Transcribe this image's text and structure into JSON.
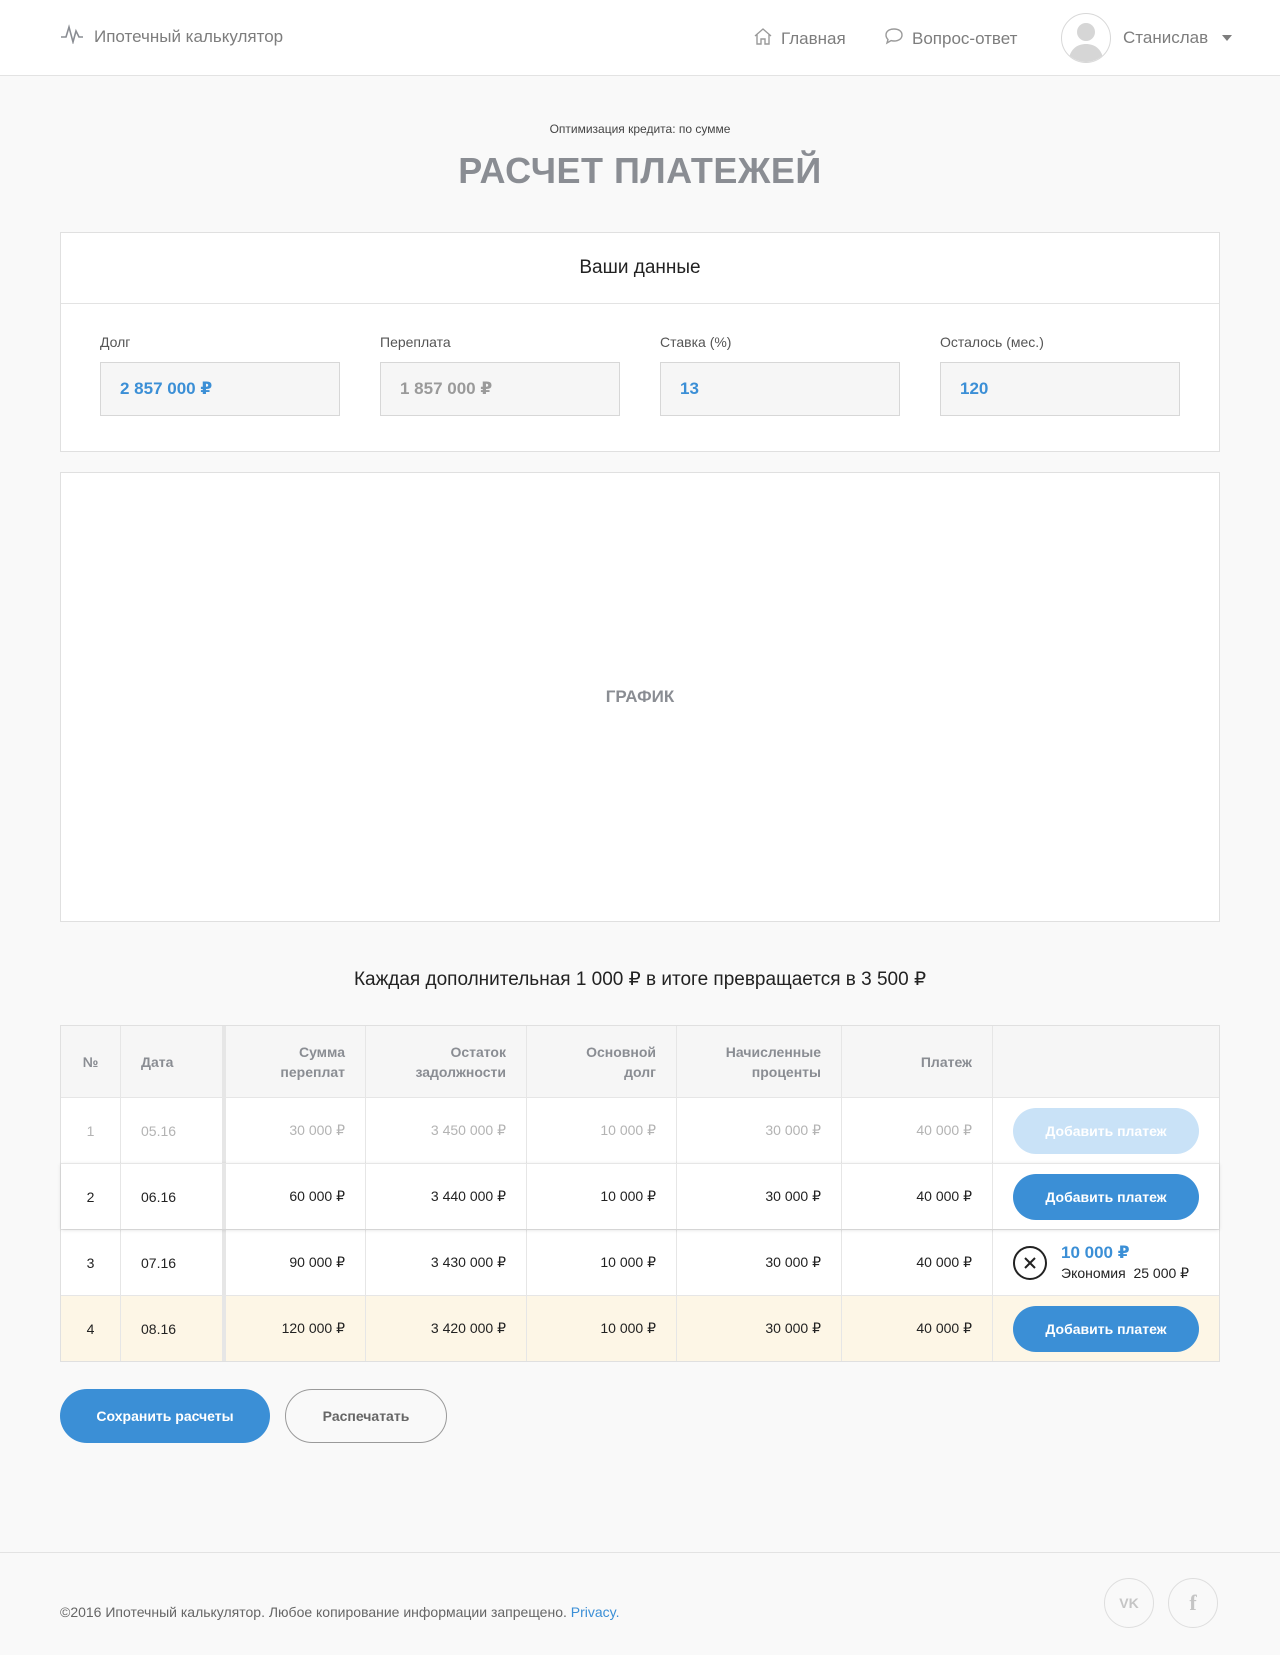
{
  "header": {
    "logo_text": "Ипотечный калькулятор",
    "nav_home": "Главная",
    "nav_faq": "Вопрос-ответ",
    "user_name": "Станислав"
  },
  "page": {
    "subtitle": "Оптимизация кредита: по сумме",
    "title": "РАСЧЕТ ПЛАТЕЖЕЙ"
  },
  "data_card": {
    "heading": "Ваши данные",
    "fields": [
      {
        "label": "Долг",
        "value": "2 857 000 ₽"
      },
      {
        "label": "Переплата",
        "value": "1 857 000 ₽"
      },
      {
        "label": "Ставка (%)",
        "value": "13"
      },
      {
        "label": "Осталось (мес.)",
        "value": "120"
      }
    ]
  },
  "chart_placeholder": "ГРАФИК",
  "promo_text": "Каждая дополнительная 1 000 ₽ в итоге превращается в 3 500 ₽",
  "table": {
    "headers": {
      "num": "№",
      "date": "Дата",
      "overpay_1": "Сумма",
      "overpay_2": "переплат",
      "debt_1": "Остаток",
      "debt_2": "задолжности",
      "main_1": "Основной",
      "main_2": "долг",
      "interest_1": "Начисленные",
      "interest_2": "проценты",
      "payment": "Платеж"
    },
    "rows": [
      {
        "num": "1",
        "date": "05.16",
        "overpay": "30 000 ₽",
        "debt": "3 450 000 ₽",
        "main": "10 000 ₽",
        "interest": "30 000 ₽",
        "payment": "40 000 ₽",
        "action": "Добавить платеж"
      },
      {
        "num": "2",
        "date": "06.16",
        "overpay": "60 000 ₽",
        "debt": "3 440 000 ₽",
        "main": "10 000 ₽",
        "interest": "30 000 ₽",
        "payment": "40 000 ₽",
        "action": "Добавить платеж"
      },
      {
        "num": "3",
        "date": "07.16",
        "overpay": "90 000 ₽",
        "debt": "3 430 000 ₽",
        "main": "10 000 ₽",
        "interest": "30 000 ₽",
        "payment": "40 000 ₽",
        "extra_amount": "10 000 ₽",
        "extra_saving_label": "Экономия",
        "extra_saving_value": "25 000 ₽"
      },
      {
        "num": "4",
        "date": "08.16",
        "overpay": "120 000 ₽",
        "debt": "3 420 000 ₽",
        "main": "10 000 ₽",
        "interest": "30 000 ₽",
        "payment": "40 000 ₽",
        "action": "Добавить платеж"
      }
    ]
  },
  "buttons": {
    "save": "Сохранить расчеты",
    "print": "Распечатать"
  },
  "footer": {
    "copyright": "©2016 Ипотечный калькулятор. Любое копирование информации запрещено.",
    "privacy": "Privacy.",
    "vk": "VK",
    "fb": "f"
  },
  "colors": {
    "accent": "#3b8fd6",
    "highlight_row": "#fdf6e6",
    "muted_text": "#8a8d93"
  }
}
